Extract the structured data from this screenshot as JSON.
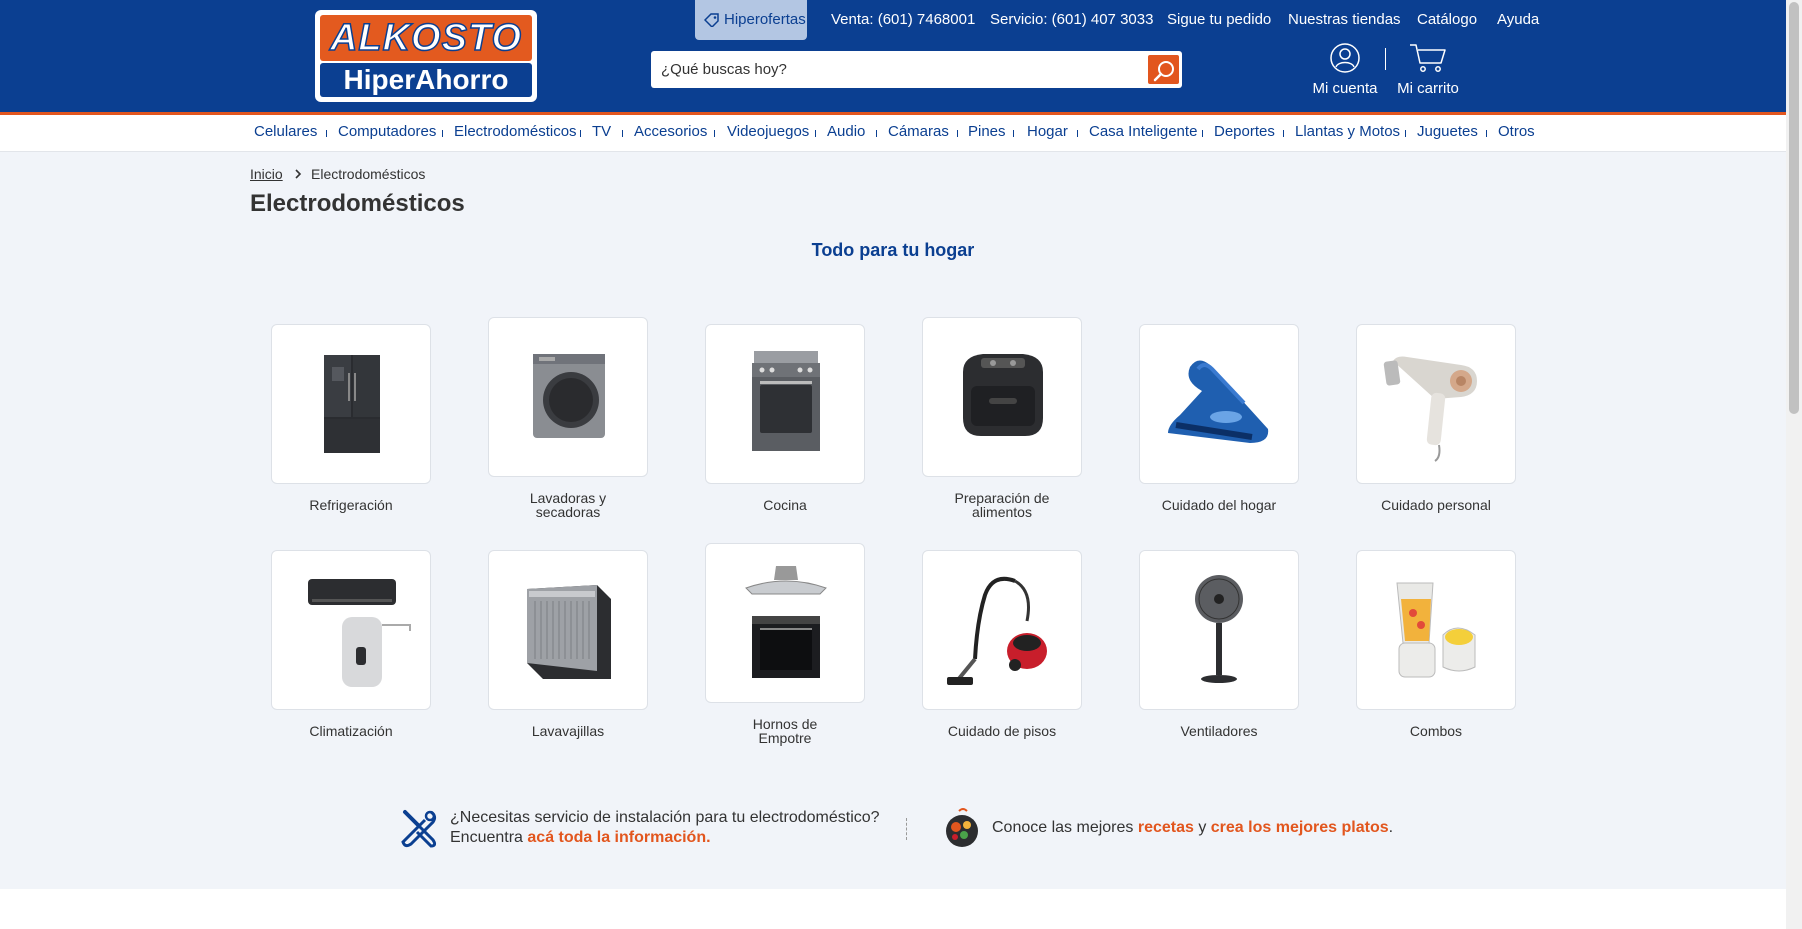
{
  "brand": {
    "logo_top": "ALKOSTO",
    "logo_bottom": "HiperAhorro"
  },
  "topnav": {
    "hiperofertas": "Hiperofertas",
    "venta": "Venta: (601) 7468001",
    "servicio": "Servicio: (601) 407 3033",
    "sigue": "Sigue tu pedido",
    "tiendas": "Nuestras tiendas",
    "catalogo": "Catálogo",
    "ayuda": "Ayuda"
  },
  "search": {
    "placeholder": "¿Qué buscas hoy?"
  },
  "account": {
    "cuenta": "Mi cuenta",
    "carrito": "Mi carrito"
  },
  "categories": [
    "Celulares",
    "Computadores",
    "Electrodomésticos",
    "TV",
    "Accesorios",
    "Videojuegos",
    "Audio",
    "Cámaras",
    "Pines",
    "Hogar",
    "Casa Inteligente",
    "Deportes",
    "Llantas y Motos",
    "Juguetes",
    "Otros"
  ],
  "breadcrumb": {
    "home": "Inicio",
    "current": "Electrodomésticos"
  },
  "page": {
    "title": "Electrodomésticos",
    "subtitle": "Todo para tu hogar"
  },
  "subcategories": [
    {
      "line1": "Refrigeración",
      "line2": "",
      "icon": "refrigerator-icon"
    },
    {
      "line1": "Lavadoras y",
      "line2": "secadoras",
      "icon": "washing-machine-icon"
    },
    {
      "line1": "Cocina",
      "line2": "",
      "icon": "stove-icon"
    },
    {
      "line1": "Preparación de",
      "line2": "alimentos",
      "icon": "air-fryer-icon"
    },
    {
      "line1": "Cuidado del hogar",
      "line2": "",
      "icon": "iron-icon"
    },
    {
      "line1": "Cuidado personal",
      "line2": "",
      "icon": "hair-dryer-icon"
    },
    {
      "line1": "Climatización",
      "line2": "",
      "icon": "air-conditioner-icon"
    },
    {
      "line1": "Lavavajillas",
      "line2": "",
      "icon": "dishwasher-icon"
    },
    {
      "line1": "Hornos de",
      "line2": "Empotre",
      "icon": "built-in-oven-icon"
    },
    {
      "line1": "Cuidado de pisos",
      "line2": "",
      "icon": "vacuum-icon"
    },
    {
      "line1": "Ventiladores",
      "line2": "",
      "icon": "fan-icon"
    },
    {
      "line1": "Combos",
      "line2": "",
      "icon": "blender-icon"
    }
  ],
  "info": {
    "left_line1": "¿Necesitas servicio de instalación para tu electrodoméstico?",
    "left_line2_pre": "Encuentra ",
    "left_link": "acá toda la información.",
    "right_pre": "Conoce las mejores ",
    "right_link1": "recetas",
    "right_mid": " y ",
    "right_link2": "crea los mejores platos",
    "right_post": "."
  },
  "colors": {
    "brand_blue": "#0b3f91",
    "brand_orange": "#e2561e"
  }
}
